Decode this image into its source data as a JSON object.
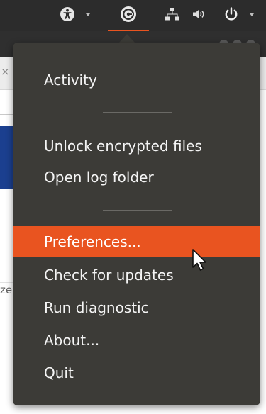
{
  "top_panel": {
    "icons": [
      "accessibility-icon",
      "app-indicator-icon",
      "network-icon",
      "volume-icon",
      "power-icon"
    ],
    "accent_color": "#e95420"
  },
  "menu": {
    "items": [
      {
        "label": "Activity"
      },
      {
        "label": "Unlock encrypted files"
      },
      {
        "label": "Open log folder"
      },
      {
        "label": "Preferences...",
        "highlighted": true
      },
      {
        "label": "Check for updates"
      },
      {
        "label": "Run diagnostic"
      },
      {
        "label": "About..."
      },
      {
        "label": "Quit"
      }
    ],
    "highlight_color": "#e95420",
    "background_color": "#3c3b37"
  },
  "background_window": {
    "side_text": "ze"
  }
}
